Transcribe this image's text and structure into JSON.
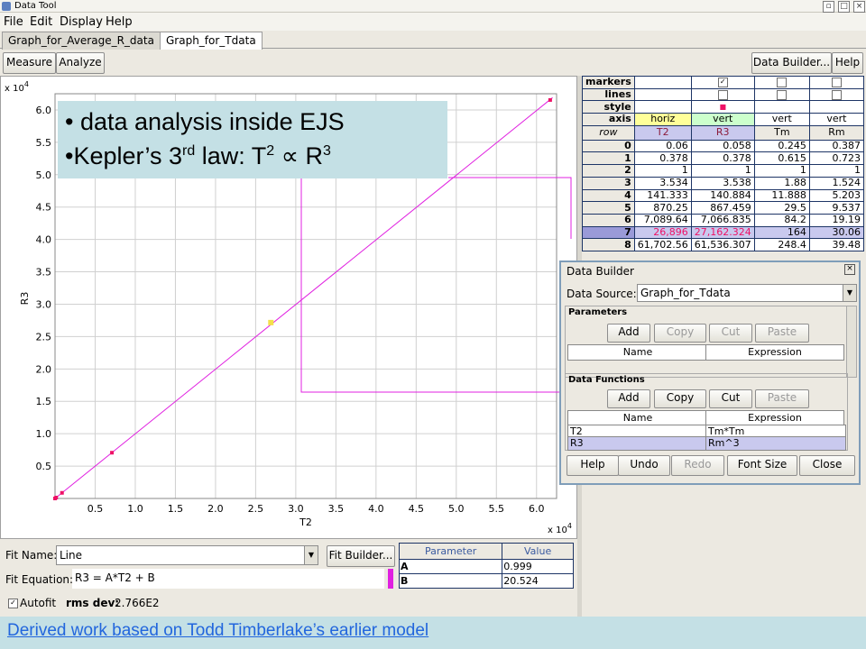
{
  "window": {
    "title": "Data Tool"
  },
  "menu": [
    "File",
    "Edit",
    "Display",
    "Help"
  ],
  "tabs": [
    "Graph_for_Average_R_data",
    "Graph_for_Tdata"
  ],
  "toolbar": {
    "measure": "Measure",
    "analyze": "Analyze",
    "data_builder": "Data Builder...",
    "help": "Help"
  },
  "overlay": {
    "line1": "• data analysis inside EJS",
    "line2_prefix": "•Kepler’s 3",
    "line2_sup1": "rd",
    "line2_mid": " law: T",
    "line2_sup2": "2",
    "line2_prop": " ∝ R",
    "line2_sup3": "3"
  },
  "chart_data": {
    "type": "scatter",
    "xlabel": "T2",
    "ylabel": "R3",
    "x_multiplier": "x 10",
    "x_multiplier_exp": "4",
    "y_multiplier": "x 10",
    "y_multiplier_exp": "4",
    "xlim": [
      0,
      6.25
    ],
    "ylim": [
      0,
      6.25
    ],
    "x_ticks": [
      "0.5",
      "1.0",
      "1.5",
      "2.0",
      "2.5",
      "3.0",
      "3.5",
      "4.0",
      "4.5",
      "5.0",
      "5.5",
      "6.0"
    ],
    "y_ticks": [
      "0.5",
      "1.0",
      "1.5",
      "2.0",
      "2.5",
      "3.0",
      "3.5",
      "4.0",
      "4.5",
      "5.0",
      "5.5",
      "6.0"
    ],
    "points_T2": [
      6e-06,
      3.78e-05,
      0.0001,
      0.0003534,
      0.0141333,
      0.087025,
      0.708964,
      2.6896,
      6.170256
    ],
    "points_R3": [
      5.8e-06,
      3.78e-05,
      0.0001,
      0.0003538,
      0.0140884,
      0.0867459,
      0.7066835,
      2.7162324,
      6.1536307
    ],
    "highlight_index": 7,
    "fit_line": {
      "x": [
        0,
        6.2
      ],
      "y": [
        0,
        6.19
      ]
    },
    "colors": {
      "line": "#e020e0",
      "marker": "#ee1166",
      "highlight": "#f4e04a"
    }
  },
  "fit": {
    "name_label": "Fit Name:",
    "name_value": "Line",
    "builder_button": "Fit Builder...",
    "equation_label": "Fit Equation:",
    "equation_value": "R3 = A*T2 + B",
    "autofit_label": "Autofit",
    "rms_label": "rms dev:",
    "rms_value": "2.766E2",
    "params_headers": [
      "Parameter",
      "Value"
    ],
    "params": [
      {
        "name": "A",
        "value": "0.999"
      },
      {
        "name": "B",
        "value": "20.524"
      }
    ]
  },
  "table": {
    "prop_labels": [
      "markers",
      "lines",
      "style",
      "axis"
    ],
    "axis": [
      "horiz",
      "vert",
      "vert",
      "vert"
    ],
    "headers": [
      "row",
      "T2",
      "R3",
      "Tm",
      "Rm"
    ],
    "rows": [
      [
        "0",
        "0.06",
        "0.058",
        "0.245",
        "0.387"
      ],
      [
        "1",
        "0.378",
        "0.378",
        "0.615",
        "0.723"
      ],
      [
        "2",
        "1",
        "1",
        "1",
        "1"
      ],
      [
        "3",
        "3.534",
        "3.538",
        "1.88",
        "1.524"
      ],
      [
        "4",
        "141.333",
        "140.884",
        "11.888",
        "5.203"
      ],
      [
        "5",
        "870.25",
        "867.459",
        "29.5",
        "9.537"
      ],
      [
        "6",
        "7,089.64",
        "7,066.835",
        "84.2",
        "19.19"
      ],
      [
        "7",
        "26,896",
        "27,162.324",
        "164",
        "30.06"
      ],
      [
        "8",
        "61,702.56",
        "61,536.307",
        "248.4",
        "39.48"
      ]
    ]
  },
  "data_builder": {
    "title": "Data Builder",
    "source_label": "Data Source:",
    "source_value": "Graph_for_Tdata",
    "params_title": "Parameters",
    "functions_title": "Data Functions",
    "btn_add": "Add",
    "btn_copy": "Copy",
    "btn_cut": "Cut",
    "btn_paste": "Paste",
    "col_name": "Name",
    "col_expr": "Expression",
    "functions": [
      {
        "name": "T2",
        "expr": "Tm*Tm"
      },
      {
        "name": "R3",
        "expr": "Rm^3"
      }
    ],
    "bottom": {
      "help": "Help",
      "undo": "Undo",
      "redo": "Redo",
      "font": "Font Size",
      "close": "Close"
    }
  },
  "footer": {
    "text": "Derived work based on Todd Timberlake’s earlier model"
  }
}
